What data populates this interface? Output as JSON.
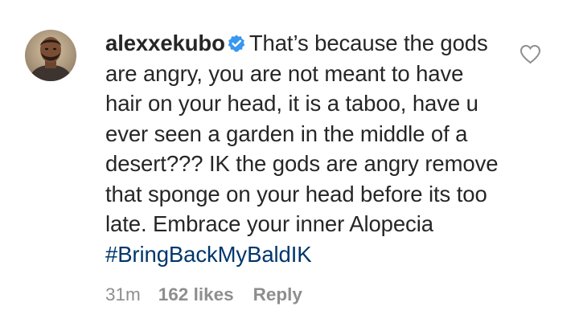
{
  "comment": {
    "username": "alexxekubo",
    "verified_icon": "verified-badge-icon",
    "text": "That’s because the gods are angry, you are not meant to have hair on your head, it is a taboo, have u ever seen a garden in the middle of a desert??? IK the gods are angry remove that sponge on your head before its too late. Embrace your inner Alopecia ",
    "hashtag": "#BringBackMyBaldIK",
    "like_icon": "heart-outline-icon"
  },
  "meta": {
    "time": "31m",
    "likes": "162 likes",
    "reply": "Reply"
  },
  "colors": {
    "text": "#262626",
    "meta": "#8e8e8e",
    "hashtag": "#00376b",
    "verified": "#3897f0"
  }
}
